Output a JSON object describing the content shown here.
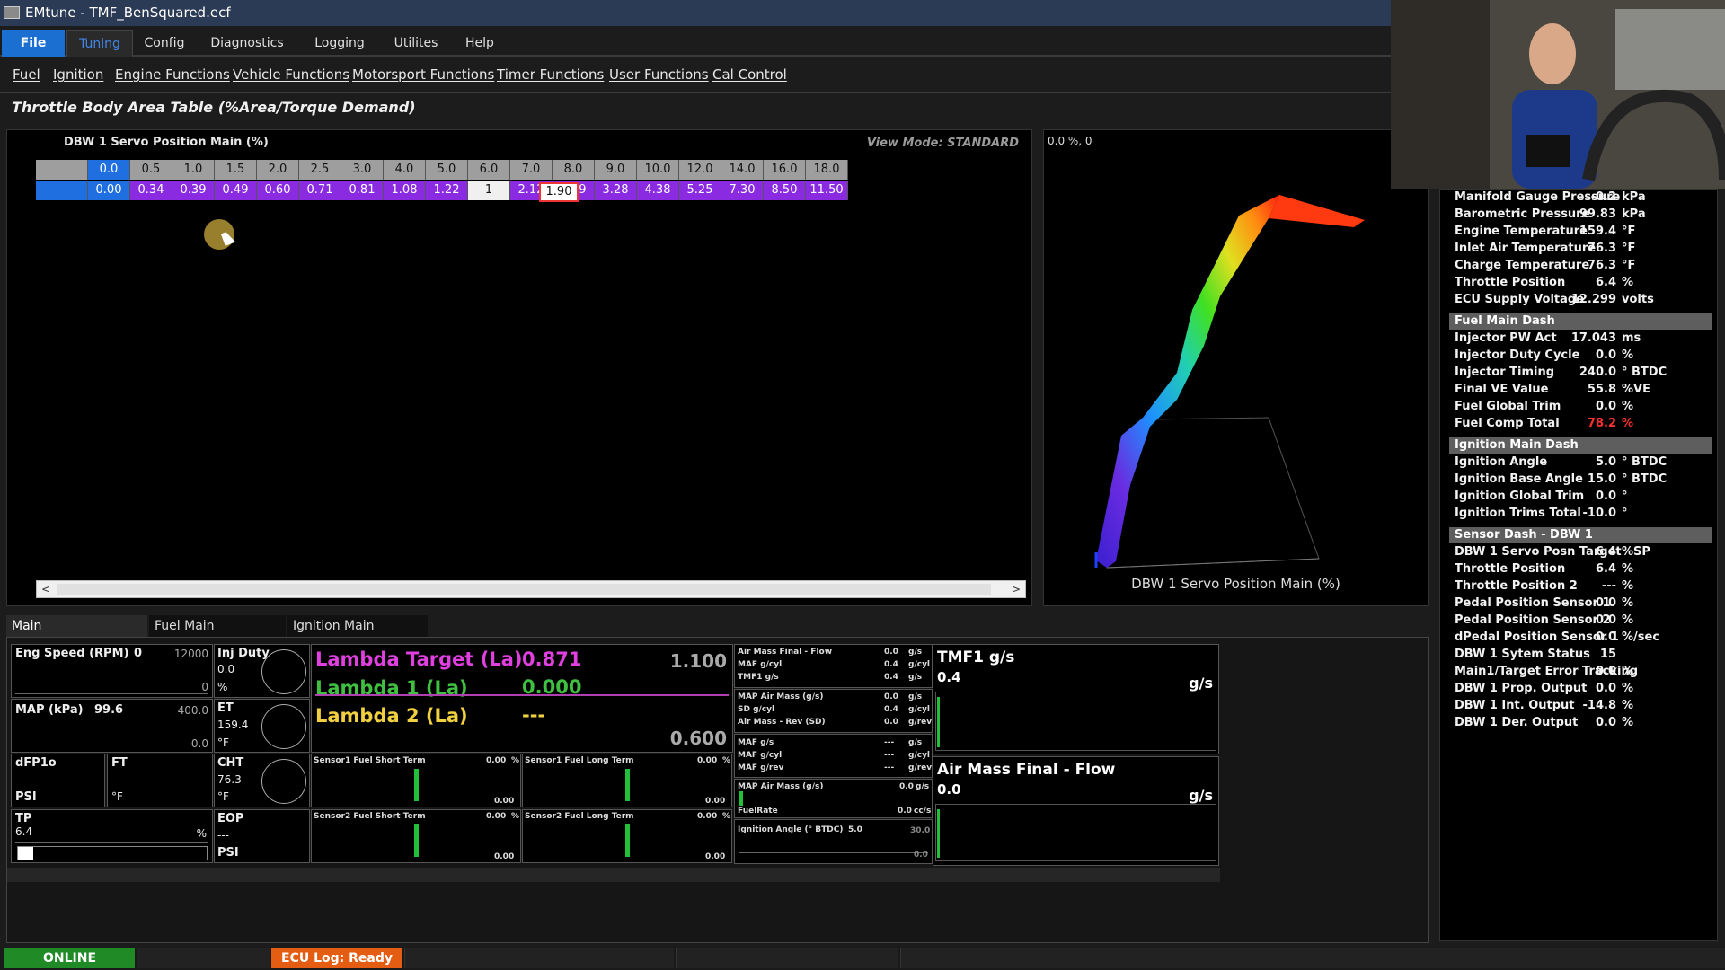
{
  "window": {
    "title": "EMtune - TMF_BenSquared.ecf"
  },
  "menu": [
    "File",
    "Tuning",
    "Config",
    "Diagnostics",
    "Logging",
    "Utilites",
    "Help"
  ],
  "toolbar": [
    "Fuel",
    "Ignition",
    "Engine Functions",
    "Vehicle Functions",
    "Motorsport Functions",
    "Timer Functions",
    "User Functions",
    "Cal Control"
  ],
  "page_title": "Throttle Body Area Table (%Area/Torque Demand)",
  "table": {
    "label": "DBW 1 Servo Position Main (%)",
    "view_mode": "View Mode: STANDARD",
    "headers": [
      "0.0",
      "0.5",
      "1.0",
      "1.5",
      "2.0",
      "2.5",
      "3.0",
      "4.0",
      "5.0",
      "6.0",
      "7.0",
      "8.0",
      "9.0",
      "10.0",
      "12.0",
      "14.0",
      "16.0",
      "18.0"
    ],
    "values": [
      "0.00",
      "0.34",
      "0.39",
      "0.49",
      "0.60",
      "0.71",
      "0.81",
      "1.08",
      "1.22",
      "1",
      "2.12",
      "2.79",
      "3.28",
      "4.38",
      "5.25",
      "7.30",
      "8.50",
      "11.50"
    ],
    "edit_value": "1.90"
  },
  "graph": {
    "coords": "0.0 %, 0",
    "title": "DBW 1 Servo Position Main (%)"
  },
  "right_panel": {
    "top_rows": [
      {
        "label": "Manifold Gauge Pressure",
        "value": "-0.2",
        "unit": "kPa"
      },
      {
        "label": "Barometric Pressure",
        "value": "99.83",
        "unit": "kPa"
      },
      {
        "label": "Engine Temperature",
        "value": "159.4",
        "unit": "°F"
      },
      {
        "label": "Inlet Air Temperature",
        "value": "76.3",
        "unit": "°F"
      },
      {
        "label": "Charge Temperature",
        "value": "76.3",
        "unit": "°F"
      },
      {
        "label": "Throttle Position",
        "value": "6.4",
        "unit": "%"
      },
      {
        "label": "ECU Supply Voltage",
        "value": "12.299",
        "unit": "volts"
      }
    ],
    "fuel_header": "Fuel Main Dash",
    "fuel_rows": [
      {
        "label": "Injector PW Act",
        "value": "17.043",
        "unit": "ms"
      },
      {
        "label": "Injector Duty Cycle",
        "value": "0.0",
        "unit": "%"
      },
      {
        "label": "Injector Timing",
        "value": "240.0",
        "unit": "° BTDC"
      },
      {
        "label": "Final VE Value",
        "value": "55.8",
        "unit": "%VE"
      },
      {
        "label": "Fuel Global Trim",
        "value": "0.0",
        "unit": "%"
      },
      {
        "label": "Fuel Comp Total",
        "value": "78.2",
        "unit": "%"
      }
    ],
    "ign_header": "Ignition Main Dash",
    "ign_rows": [
      {
        "label": "Ignition Angle",
        "value": "5.0",
        "unit": "° BTDC"
      },
      {
        "label": "Ignition Base Angle",
        "value": "15.0",
        "unit": "° BTDC"
      },
      {
        "label": "Ignition Global Trim",
        "value": "0.0",
        "unit": "°"
      },
      {
        "label": "Ignition Trims Total",
        "value": "-10.0",
        "unit": "°"
      }
    ],
    "sensor_header": "Sensor Dash - DBW 1",
    "sensor_rows": [
      {
        "label": "DBW 1 Servo Posn Target",
        "value": "6.4",
        "unit": "%SP"
      },
      {
        "label": "Throttle Position",
        "value": "6.4",
        "unit": "%"
      },
      {
        "label": "Throttle Position 2",
        "value": "---",
        "unit": "%"
      },
      {
        "label": "Pedal Position Sensor 1",
        "value": "0.0",
        "unit": "%"
      },
      {
        "label": "Pedal Position Sensor  2",
        "value": "0.0",
        "unit": "%"
      },
      {
        "label": "dPedal Position Sensor 1",
        "value": "0.0",
        "unit": "%/sec"
      },
      {
        "label": "DBW 1 Sytem Status",
        "value": "15",
        "unit": ""
      },
      {
        "label": "Main1/Target Error Tracking",
        "value": "0.0",
        "unit": "%"
      },
      {
        "label": "DBW 1 Prop. Output",
        "value": "0.0",
        "unit": "%"
      },
      {
        "label": "DBW 1 Int. Output",
        "value": "-14.8",
        "unit": "%"
      },
      {
        "label": "DBW 1 Der. Output",
        "value": "0.0",
        "unit": "%"
      }
    ]
  },
  "tabs": [
    "Main",
    "Fuel Main",
    "Ignition Main"
  ],
  "dash": {
    "eng_speed": {
      "label": "Eng Speed (RPM)",
      "value": "0",
      "max": "12000",
      "min": "0"
    },
    "inj_duty": {
      "label": "Inj Duty",
      "value": "0.0",
      "unit": "%"
    },
    "map": {
      "label": "MAP (kPa)",
      "value": "99.6",
      "max": "400.0",
      "min": "0.0"
    },
    "et": {
      "label": "ET",
      "value": "159.4",
      "unit": "°F"
    },
    "dfp": {
      "label": "dFP1o",
      "value": "---",
      "unit": "PSI"
    },
    "ft": {
      "label": "FT",
      "value": "---",
      "unit": "°F"
    },
    "cht": {
      "label": "CHT",
      "value": "76.3",
      "unit": "°F"
    },
    "tp": {
      "label": "TP",
      "value": "6.4",
      "unit": "%"
    },
    "eop": {
      "label": "EOP",
      "value": "---",
      "unit": "PSI"
    },
    "lambda_target": {
      "label": "Lambda Target (La)",
      "value": "0.871"
    },
    "lambda1": {
      "label": "Lambda 1 (La)",
      "value": "0.000"
    },
    "lambda2": {
      "label": "Lambda 2 (La)",
      "value": "---"
    },
    "lambda_max": "1.100",
    "lambda_min": "0.600",
    "trims": [
      {
        "label": "Sensor1 Fuel Short Term",
        "value": "0.00",
        "unit": "%",
        "min": "0.00"
      },
      {
        "label": "Sensor1 Fuel Long Term",
        "value": "0.00",
        "unit": "%",
        "min": "0.00"
      },
      {
        "label": "Sensor2 Fuel Short Term",
        "value": "0.00",
        "unit": "%",
        "min": "0.00"
      },
      {
        "label": "Sensor2 Fuel Long Term",
        "value": "0.00",
        "unit": "%",
        "min": "0.00"
      }
    ],
    "airmass1": [
      {
        "label": "Air Mass Final - Flow",
        "value": "0.0",
        "unit": "g/s"
      },
      {
        "label": "MAF g/cyl",
        "value": "0.4",
        "unit": "g/cyl"
      },
      {
        "label": "TMF1 g/s",
        "value": "0.4",
        "unit": "g/s"
      }
    ],
    "airmass2": [
      {
        "label": "MAP Air Mass (g/s)",
        "value": "0.0",
        "unit": "g/s"
      },
      {
        "label": "SD g/cyl",
        "value": "0.4",
        "unit": "g/cyl"
      },
      {
        "label": "Air Mass - Rev (SD)",
        "value": "0.0",
        "unit": "g/rev"
      }
    ],
    "airmass3": [
      {
        "label": "MAF g/s",
        "value": "---",
        "unit": "g/s"
      },
      {
        "label": "MAF g/cyl",
        "value": "---",
        "unit": "g/cyl"
      },
      {
        "label": "MAF g/rev",
        "value": "---",
        "unit": "g/rev"
      }
    ],
    "mapairmass": {
      "label": "MAP Air Mass (g/s)",
      "value": "0.0",
      "unit": "g/s"
    },
    "fuelrate": {
      "label": "FuelRate",
      "value": "0.0",
      "unit": "cc/s"
    },
    "ign_angle": {
      "label": "Ignition Angle (° BTDC)",
      "value": "5.0",
      "max": "30.0",
      "min": "0.0"
    },
    "tmf1": {
      "label": "TMF1 g/s",
      "value": "0.4",
      "unit": "g/s"
    },
    "amf": {
      "label": "Air Mass Final - Flow",
      "value": "0.0",
      "unit": "g/s"
    }
  },
  "status": {
    "online": "ONLINE",
    "ecu_log": "ECU Log: Ready"
  },
  "colors": {
    "accent": "#1f6fe0",
    "table_cell": "#8a2be2",
    "online": "#1f8a26",
    "ecu_log": "#e55d12",
    "lambda_target": "#e040e0",
    "lambda1": "#40c040",
    "lambda2": "#f0d040",
    "alert": "#ff3030"
  }
}
